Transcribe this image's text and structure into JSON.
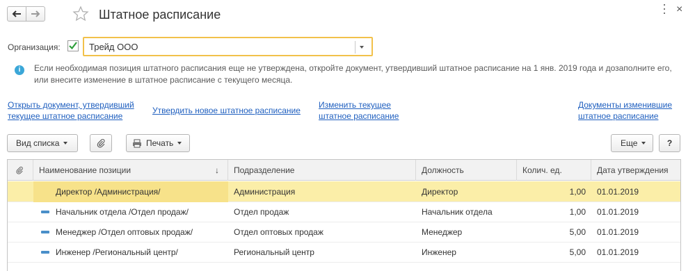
{
  "window": {
    "title": "Штатное расписание",
    "close_symbol": "×"
  },
  "organization": {
    "label": "Организация:",
    "value": "Трейд ООО",
    "checked": true
  },
  "info": {
    "text": "Если необходимая позиция штатного расписания еще не утверждена, откройте документ, утвердивший штатное расписание на 1 янв. 2019 года и дозаполните его, или внесите изменение в штатное расписание с текущего месяца."
  },
  "links": {
    "open_doc_line1": "Открыть документ, утвердивший",
    "open_doc_line2": "текущее штатное расписание",
    "approve_new": "Утвердить новое штатное расписание",
    "change_current_line1": "Изменить текущее",
    "change_current_line2": "штатное расписание",
    "docs_changed_line1": "Документы изменившие",
    "docs_changed_line2": "штатное расписание"
  },
  "toolbar": {
    "view_list": "Вид списка",
    "print": "Печать",
    "more": "Еще",
    "help": "?"
  },
  "table": {
    "columns": [
      "Наименование позиции",
      "Подразделение",
      "Должность",
      "Колич. ед.",
      "Дата утверждения"
    ],
    "sort_indicator": "↓",
    "rows": [
      {
        "name": "Директор /Администрация/",
        "department": "Администрация",
        "position": "Директор",
        "units": "1,00",
        "date": "01.01.2019"
      },
      {
        "name": "Начальник отдела /Отдел продаж/",
        "department": "Отдел продаж",
        "position": "Начальник отдела",
        "units": "1,00",
        "date": "01.01.2019"
      },
      {
        "name": "Менеджер /Отдел оптовых продаж/",
        "department": "Отдел оптовых продаж",
        "position": "Менеджер",
        "units": "5,00",
        "date": "01.01.2019"
      },
      {
        "name": "Инженер /Региональный центр/",
        "department": "Региональный центр",
        "position": "Инженер",
        "units": "5,00",
        "date": "01.01.2019"
      }
    ],
    "selected_row": 0
  },
  "colors": {
    "accent_border": "#f2c14a",
    "link": "#1f5fbf",
    "selected_row": "#fbeea8",
    "check": "#2e9e3a",
    "info": "#3ba7d8"
  },
  "icons": {
    "back": "arrow-left-icon",
    "forward": "arrow-right-icon",
    "favorite": "star-icon",
    "more": "more-dots-icon",
    "close": "close-icon",
    "check": "checkmark-icon",
    "dropdown": "chevron-down-icon",
    "info": "info-icon",
    "attach": "paperclip-icon",
    "print": "printer-icon",
    "row": "position-icon"
  }
}
